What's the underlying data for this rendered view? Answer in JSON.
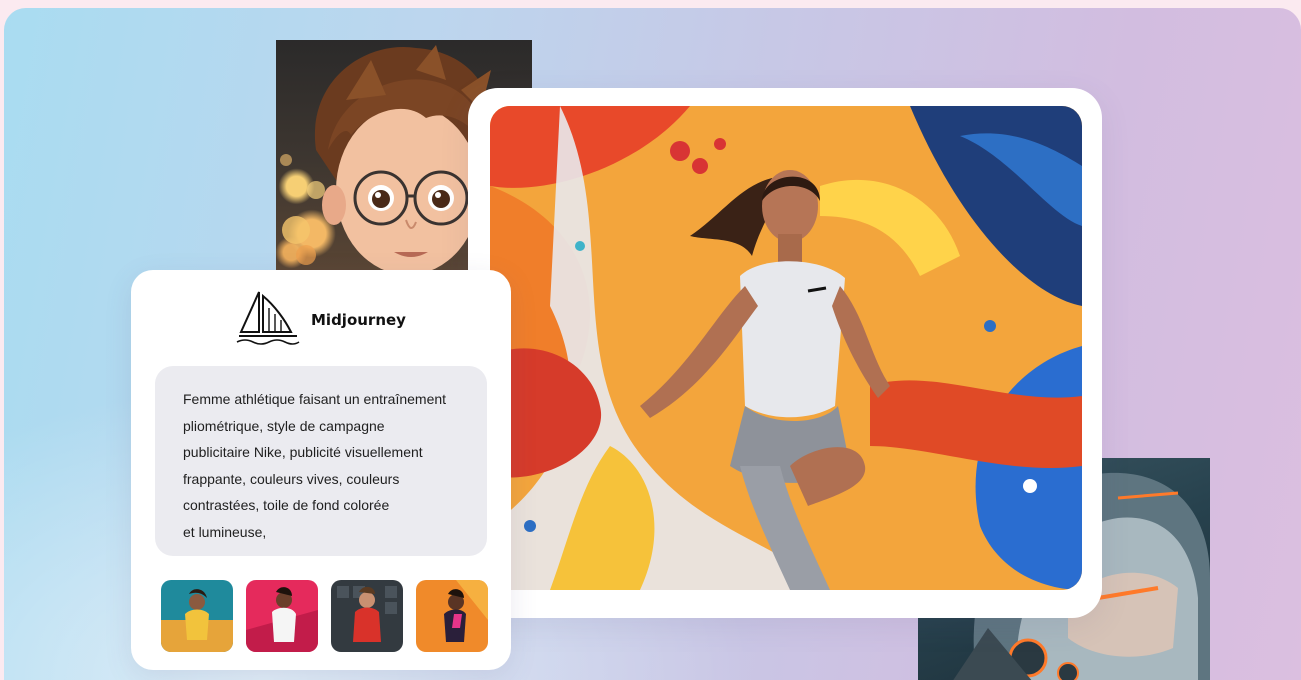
{
  "brand": {
    "name": "Midjourney",
    "logo_icon": "sailboat-logo-icon"
  },
  "prompt": {
    "text": "Femme athlétique faisant un entraînement\npliométrique, style de campagne\npublicitaire Nike, publicité visuellement\nfrappante, couleurs vives, couleurs\ncontrastées, toile de fond colorée\net lumineuse,"
  },
  "images": {
    "boy_portrait": "boy-with-glasses-portrait",
    "robot_portrait": "robot-helmet-portrait",
    "main": "athlete-woman-running-colorful-background"
  },
  "thumbnails": [
    {
      "name": "thumb-athlete-teal"
    },
    {
      "name": "thumb-athlete-pink"
    },
    {
      "name": "thumb-athlete-dark-red"
    },
    {
      "name": "thumb-athlete-orange"
    }
  ],
  "colors": {
    "background_left": "#a9dcf1",
    "background_right": "#dbbfe0",
    "card": "#ffffff",
    "prompt_box": "#ebebf0",
    "brand_text": "#111111"
  }
}
